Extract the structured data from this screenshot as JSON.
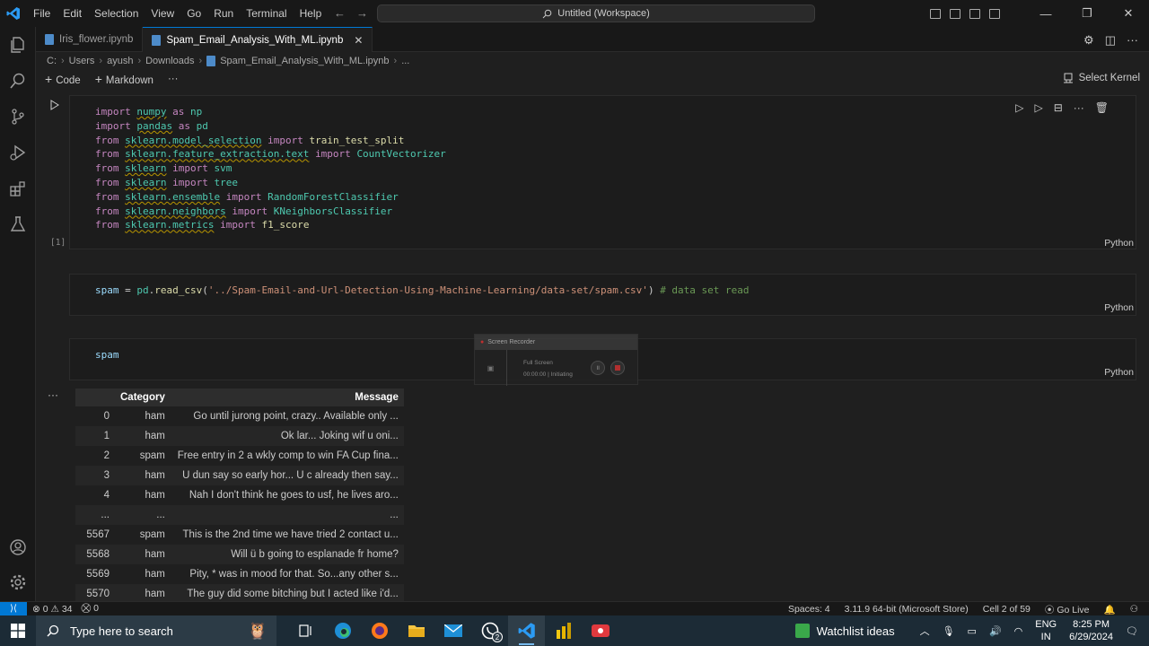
{
  "titlebar": {
    "menu": [
      "File",
      "Edit",
      "Selection",
      "View",
      "Go",
      "Run",
      "Terminal",
      "Help"
    ],
    "search": "Untitled (Workspace)"
  },
  "tabs": [
    {
      "label": "Iris_flower.ipynb",
      "active": false
    },
    {
      "label": "Spam_Email_Analysis_With_ML.ipynb",
      "active": true
    }
  ],
  "breadcrumb": [
    "C:",
    "Users",
    "ayush",
    "Downloads",
    "Spam_Email_Analysis_With_ML.ipynb",
    "..."
  ],
  "nbtoolbar": {
    "code": "Code",
    "markdown": "Markdown",
    "more": "···",
    "kernel": "Select Kernel"
  },
  "cells": [
    {
      "exec_count": "[1]",
      "language": "Python"
    },
    {
      "exec_count": "",
      "language": "Python"
    },
    {
      "exec_count": "",
      "language": "Python"
    }
  ],
  "output": {
    "dots": "···",
    "headers": [
      "",
      "Category",
      "Message"
    ],
    "rows": [
      [
        "0",
        "ham",
        "Go until jurong point, crazy.. Available only ..."
      ],
      [
        "1",
        "ham",
        "Ok lar... Joking wif u oni..."
      ],
      [
        "2",
        "spam",
        "Free entry in 2 a wkly comp to win FA Cup fina..."
      ],
      [
        "3",
        "ham",
        "U dun say so early hor... U c already then say..."
      ],
      [
        "4",
        "ham",
        "Nah I don't think he goes to usf, he lives aro..."
      ],
      [
        "...",
        "...",
        "..."
      ],
      [
        "5567",
        "spam",
        "This is the 2nd time we have tried 2 contact u..."
      ],
      [
        "5568",
        "ham",
        "Will ü b going to esplanade fr home?"
      ],
      [
        "5569",
        "ham",
        "Pity, * was in mood for that. So...any other s..."
      ],
      [
        "5570",
        "ham",
        "The guy did some bitching but I acted like i'd..."
      ]
    ]
  },
  "recorder": {
    "title": "Screen Recorder",
    "mode": "Full Screen",
    "status": "00:00:00 | Initiating"
  },
  "statusbar": {
    "errors": "0",
    "warnings": "34",
    "ports": "0",
    "spaces": "Spaces: 4",
    "interpreter": "3.11.9 64-bit (Microsoft Store)",
    "cell": "Cell 2 of 59",
    "golive": "Go Live"
  },
  "taskbar": {
    "search_placeholder": "Type here to search",
    "watchlist": "Watchlist ideas",
    "lang1": "ENG",
    "lang2": "IN",
    "time": "8:25 PM",
    "date": "6/29/2024",
    "whatsapp_badge": "2"
  }
}
